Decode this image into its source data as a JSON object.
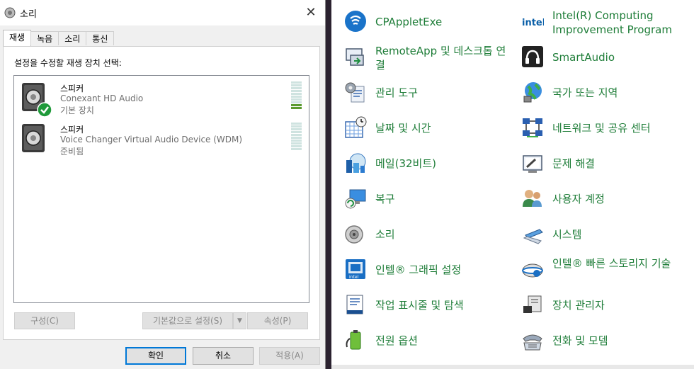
{
  "dialog": {
    "title": "소리",
    "close": "✕",
    "tabs": [
      "재생",
      "녹음",
      "소리",
      "통신"
    ],
    "instruction": "설정을 수정할 재생 장치 선택:",
    "devices": [
      {
        "name": "스피커",
        "description": "Conexant HD Audio",
        "state": "기본 장치",
        "default": true
      },
      {
        "name": "스피커",
        "description": "Voice Changer Virtual Audio Device (WDM)",
        "state": "준비됨",
        "default": false
      }
    ],
    "buttons": {
      "configure": "구성(C)",
      "set_default": "기본값으로 설정(S)",
      "properties": "속성(P)",
      "ok": "확인",
      "cancel": "취소",
      "apply": "적용(A)"
    }
  },
  "control_panel": {
    "items": [
      {
        "label": "CPAppletExe",
        "icon": "cpapplet-icon"
      },
      {
        "label": "Intel(R) Computing Improvement Program",
        "icon": "intel-icon"
      },
      {
        "label": "RemoteApp 및 데스크톱 연결",
        "icon": "remoteapp-icon"
      },
      {
        "label": "SmartAudio",
        "icon": "headphones-icon"
      },
      {
        "label": "관리 도구",
        "icon": "admin-tools-icon"
      },
      {
        "label": "국가 또는 지역",
        "icon": "globe-icon"
      },
      {
        "label": "날짜 및 시간",
        "icon": "calendar-icon"
      },
      {
        "label": "네트워크 및 공유 센터",
        "icon": "network-icon"
      },
      {
        "label": "메일(32비트)",
        "icon": "mail-icon"
      },
      {
        "label": "문제 해결",
        "icon": "troubleshoot-icon"
      },
      {
        "label": "복구",
        "icon": "recovery-icon"
      },
      {
        "label": "사용자 계정",
        "icon": "users-icon"
      },
      {
        "label": "소리",
        "icon": "speaker-icon"
      },
      {
        "label": "시스템",
        "icon": "system-icon"
      },
      {
        "label": "인텔® 그래픽 설정",
        "icon": "intel-graphics-icon"
      },
      {
        "label": "인텔® 빠른 스토리지 기술",
        "icon": "intel-storage-icon"
      },
      {
        "label": "작업 표시줄 및 탐색",
        "icon": "taskbar-icon"
      },
      {
        "label": "장치 관리자",
        "icon": "device-manager-icon"
      },
      {
        "label": "전원 옵션",
        "icon": "power-icon"
      },
      {
        "label": "전화 및 모뎀",
        "icon": "phone-icon"
      }
    ]
  },
  "colors": {
    "link_green": "#1e7d38",
    "accent_blue": "#0078d7",
    "check_green": "#1f9a3a"
  }
}
